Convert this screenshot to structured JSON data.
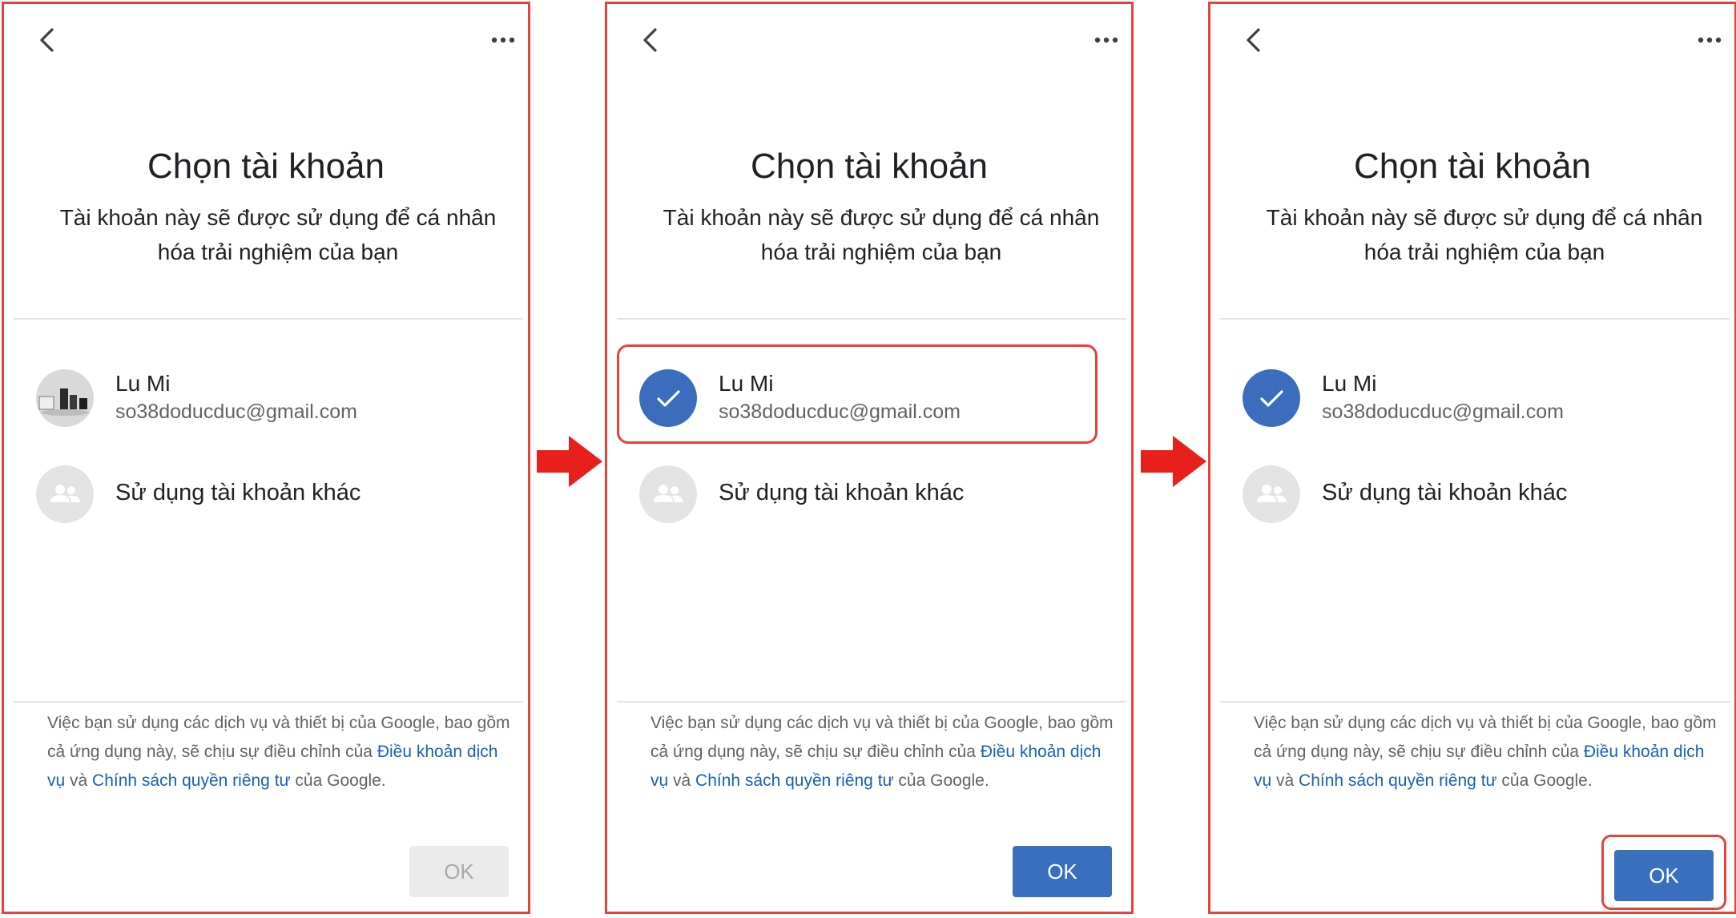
{
  "colors": {
    "highlight_border": "#e8413c",
    "primary_button": "#3a6fbe",
    "link": "#1a5fb4",
    "check_avatar": "#3c6dbd"
  },
  "panels": [
    {
      "step": 1,
      "title": "Chọn tài khoản",
      "subtitle": "Tài khoản này sẽ được sử dụng để cá nhân hóa trải nghiệm của bạn",
      "account": {
        "name": "Lu Mi",
        "email": "so38doducduc@gmail.com",
        "selected": false,
        "avatar_icon": "profile-photo-icon"
      },
      "other_account_label": "Sử dụng tài khoản khác",
      "terms": {
        "text_before": "Việc bạn sử dụng các dịch vụ và thiết bị của Google, bao gồm cả ứng dụng này, sẽ chịu sự điều chỉnh của ",
        "link1": "Điều khoản dịch vụ",
        "text_middle": " và ",
        "link2": "Chính sách quyền riêng tư",
        "text_after": " của Google."
      },
      "ok_label": "OK",
      "ok_state": "disabled"
    },
    {
      "step": 2,
      "title": "Chọn tài khoản",
      "subtitle": "Tài khoản này sẽ được sử dụng để cá nhân hóa trải nghiệm của bạn",
      "account": {
        "name": "Lu Mi",
        "email": "so38doducduc@gmail.com",
        "selected": true,
        "avatar_icon": "checkmark-icon"
      },
      "other_account_label": "Sử dụng tài khoản khác",
      "terms": {
        "text_before": "Việc bạn sử dụng các dịch vụ và thiết bị của Google, bao gồm cả ứng dụng này, sẽ chịu sự điều chỉnh của ",
        "link1": "Điều khoản dịch vụ",
        "text_middle": " và ",
        "link2": "Chính sách quyền riêng tư",
        "text_after": " của Google."
      },
      "ok_label": "OK",
      "ok_state": "enabled"
    },
    {
      "step": 3,
      "title": "Chọn tài khoản",
      "subtitle": "Tài khoản này sẽ được sử dụng để cá nhân hóa trải nghiệm của bạn",
      "account": {
        "name": "Lu Mi",
        "email": "so38doducduc@gmail.com",
        "selected": true,
        "avatar_icon": "checkmark-icon"
      },
      "other_account_label": "Sử dụng tài khoản khác",
      "terms": {
        "text_before": "Việc bạn sử dụng các dịch vụ và thiết bị của Google, bao gồm cả ứng dụng này, sẽ chịu sự điều chỉnh của ",
        "link1": "Điều khoản dịch vụ",
        "text_middle": " và ",
        "link2": "Chính sách quyền riêng tư",
        "text_after": " của Google."
      },
      "ok_label": "OK",
      "ok_state": "enabled"
    }
  ],
  "step_arrows": [
    "right-arrow-icon",
    "right-arrow-icon"
  ]
}
